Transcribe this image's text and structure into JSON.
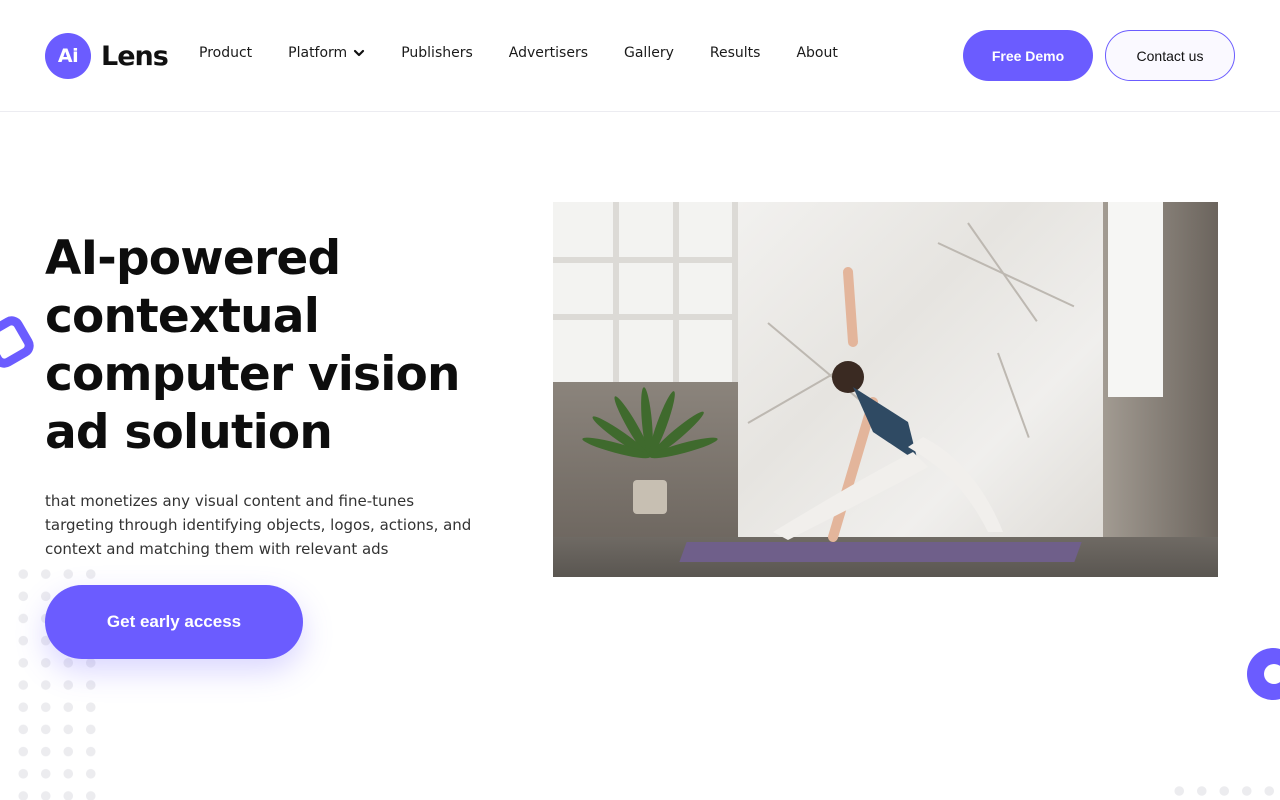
{
  "brand": {
    "badge": "Ai",
    "name": "Lens",
    "accent_color": "#6b5cff"
  },
  "nav": {
    "items": [
      {
        "label": "Product",
        "has_dropdown": false
      },
      {
        "label": "Platform",
        "has_dropdown": true,
        "icon": "chevron-down-icon"
      },
      {
        "label": "Publishers",
        "has_dropdown": false
      },
      {
        "label": "Advertisers",
        "has_dropdown": false
      },
      {
        "label": "Gallery",
        "has_dropdown": false
      },
      {
        "label": "Results",
        "has_dropdown": false
      },
      {
        "label": "About",
        "has_dropdown": false
      }
    ]
  },
  "header_actions": {
    "demo_label": "Free Demo",
    "contact_label": "Contact us"
  },
  "hero": {
    "title": "AI-powered contextual computer vision ad solution",
    "subtitle": "that monetizes any visual content and fine-tunes targeting through identifying objects, logos, actions, and context and matching them with relevant ads",
    "cta_label": "Get early access",
    "image": "photo of woman in yoga pose beside potted plant"
  }
}
